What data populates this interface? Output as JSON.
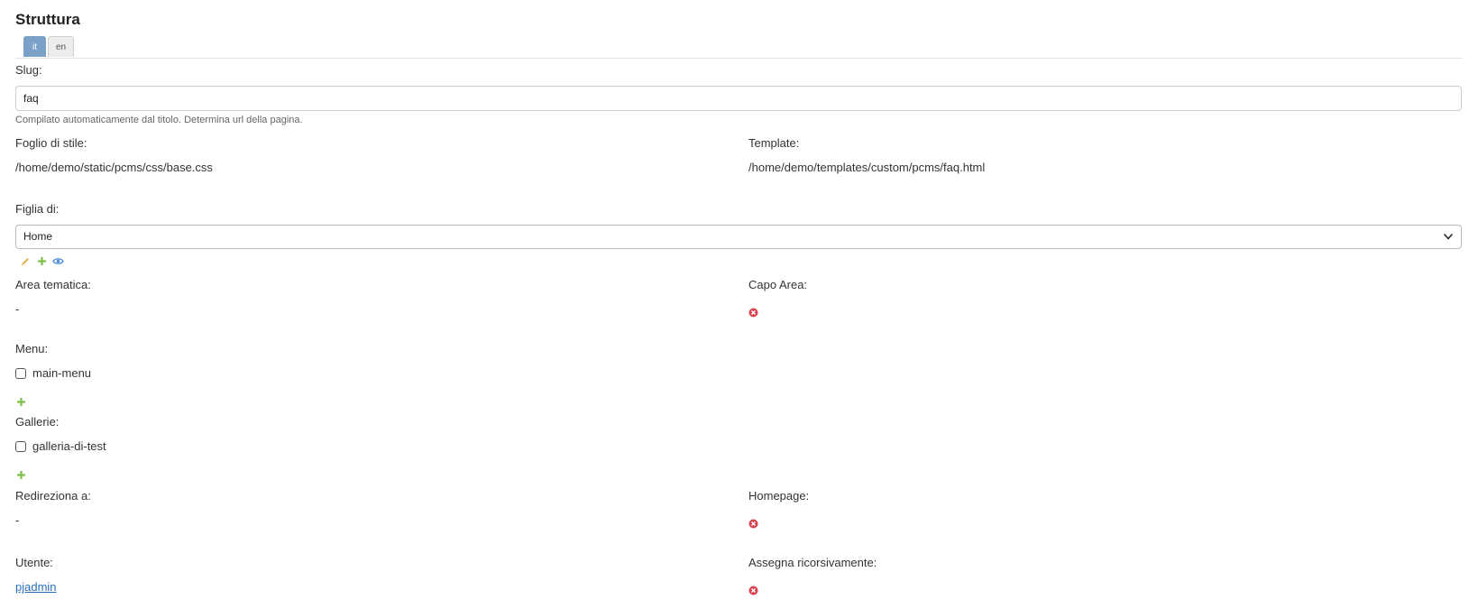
{
  "section": {
    "title": "Struttura"
  },
  "language_tabs": [
    {
      "label": "it",
      "active": true
    },
    {
      "label": "en",
      "active": false
    }
  ],
  "slug": {
    "label": "Slug:",
    "value": "faq",
    "help": "Compilato automaticamente dal titolo. Determina url della pagina."
  },
  "stylesheet": {
    "label": "Foglio di stile:",
    "value": "/home/demo/static/pcms/css/base.css"
  },
  "template": {
    "label": "Template:",
    "value": "/home/demo/templates/custom/pcms/faq.html"
  },
  "parent": {
    "label": "Figlia di:",
    "selected": "Home",
    "actions": [
      "pencil-icon",
      "plus-icon",
      "eye-icon"
    ]
  },
  "area_tematica": {
    "label": "Area tematica:",
    "value": "-"
  },
  "capo_area": {
    "label": "Capo Area:",
    "value_icon": "x-circle-icon"
  },
  "menu": {
    "label": "Menu:",
    "options": [
      {
        "label": "main-menu",
        "checked": false
      }
    ]
  },
  "gallerie": {
    "label": "Gallerie:",
    "options": [
      {
        "label": "galleria-di-test",
        "checked": false
      }
    ]
  },
  "redirect": {
    "label": "Redireziona a:",
    "value": "-"
  },
  "homepage": {
    "label": "Homepage:",
    "value_icon": "x-circle-icon"
  },
  "utente": {
    "label": "Utente:",
    "value": "pjadmin"
  },
  "assegna": {
    "label": "Assegna ricorsivamente:",
    "value_icon": "x-circle-icon"
  },
  "colors": {
    "accent_tab": "#7ba1c8",
    "add_green": "#7cc14a",
    "false_red": "#d9434e",
    "edit_yellow": "#e2b64a",
    "view_blue": "#4a8cd9",
    "link": "#2a6fbb"
  }
}
